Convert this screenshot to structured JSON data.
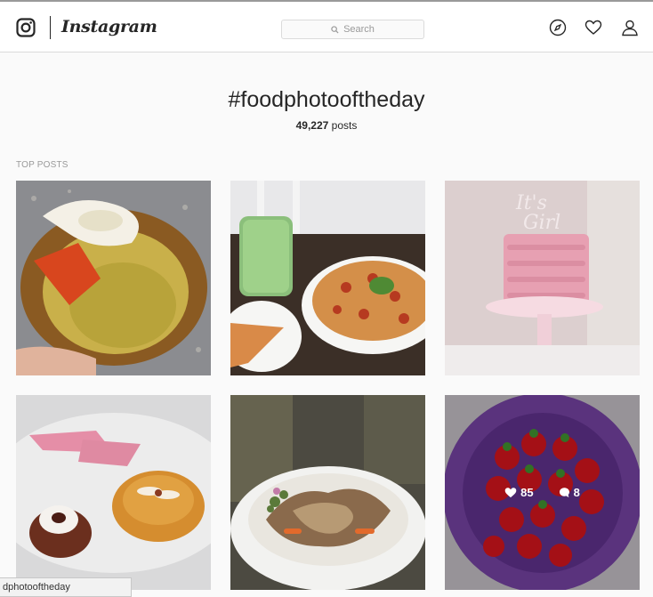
{
  "header": {
    "brand": "Instagram",
    "search_placeholder": "Search",
    "icons": [
      "instagram-logo-icon",
      "search-icon",
      "explore-compass-icon",
      "heart-icon",
      "profile-icon"
    ]
  },
  "tag": {
    "title": "#foodphotooftheday",
    "post_count": "49,227",
    "post_count_suffix": "posts"
  },
  "section": {
    "label": "TOP POSTS"
  },
  "posts": [
    {
      "subject": "lobster crab rice"
    },
    {
      "subject": "pizza and green drink"
    },
    {
      "subject": "pink It's Girl cake"
    },
    {
      "subject": "dessert plate"
    },
    {
      "subject": "meat dish in bowl"
    },
    {
      "subject": "strawberries in purple colander",
      "likes": "85",
      "comments": "8"
    }
  ],
  "status_bar": {
    "text": "dphotooftheday"
  },
  "colors": {
    "text": "#262626",
    "muted": "#999999",
    "border": "#dbdbdb",
    "background": "#fafafa"
  }
}
